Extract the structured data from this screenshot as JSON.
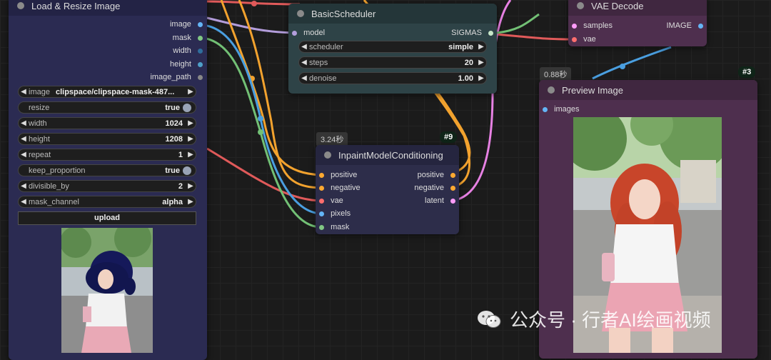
{
  "nodes": {
    "load_resize": {
      "title": "Load & Resize Image",
      "outputs": [
        "image",
        "mask",
        "width",
        "height",
        "image_path"
      ],
      "widgets": [
        {
          "label": "image",
          "value": "clipspace/clipspace-mask-487..."
        },
        {
          "label": "resize",
          "value": "true"
        },
        {
          "label": "width",
          "value": "1024"
        },
        {
          "label": "height",
          "value": "1208"
        },
        {
          "label": "repeat",
          "value": "1"
        },
        {
          "label": "keep_proportion",
          "value": "true"
        },
        {
          "label": "divisible_by",
          "value": "2"
        },
        {
          "label": "mask_channel",
          "value": "alpha"
        }
      ],
      "upload_label": "upload"
    },
    "basic_scheduler": {
      "title": "BasicScheduler",
      "input": "model",
      "output": "SIGMAS",
      "widgets": [
        {
          "label": "scheduler",
          "value": "simple"
        },
        {
          "label": "steps",
          "value": "20"
        },
        {
          "label": "denoise",
          "value": "1.00"
        }
      ]
    },
    "vae_decode": {
      "title": "VAE Decode",
      "inputs": [
        "samples",
        "vae"
      ],
      "output": "IMAGE"
    },
    "inpaint": {
      "title": "InpaintModelConditioning",
      "time": "3.24秒",
      "id": "#9",
      "inputs": [
        "positive",
        "negative",
        "vae",
        "pixels",
        "mask"
      ],
      "outputs": [
        "positive",
        "negative",
        "latent"
      ]
    },
    "preview": {
      "title": "Preview Image",
      "time": "0.88秒",
      "id": "#3",
      "input": "images"
    }
  },
  "watermark": "公众号 · 行者AI绘画视频",
  "colors": {
    "node_body": "#353535",
    "load_node_body": "#2b2b52",
    "preview_body": "#4e2f4e",
    "inpaint_body": "#2d2d4a",
    "scheduler_body": "#2e4347",
    "port_image": "#64b5f6",
    "port_mask": "#81c784",
    "port_vae": "#ff6e6e",
    "port_conditioning": "#ffa931",
    "port_latent": "#ff9cf9",
    "port_model": "#b39ddb",
    "port_int": "#4ea0c9"
  }
}
